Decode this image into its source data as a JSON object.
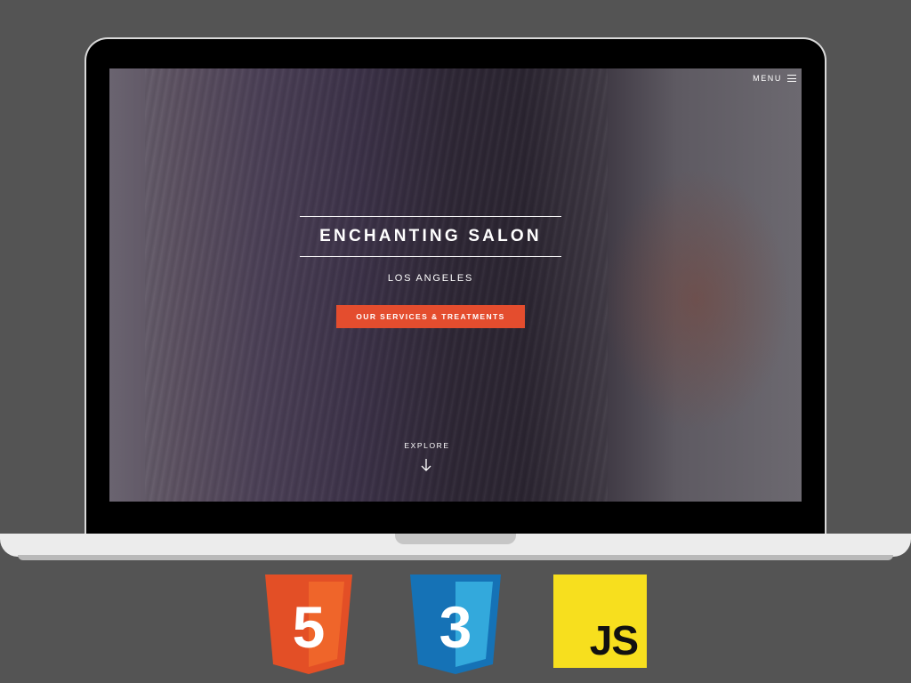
{
  "site": {
    "menu_label": "MENU",
    "title": "ENCHANTING SALON",
    "subtitle": "LOS ANGELES",
    "cta_label": "OUR SERVICES & TREATMENTS",
    "explore_label": "EXPLORE"
  },
  "logos": {
    "html": {
      "digit": "5",
      "color": "#e34f26"
    },
    "css": {
      "digit": "3",
      "color": "#1572b6"
    },
    "js": {
      "text": "JS",
      "color": "#f7df1e"
    }
  },
  "colors": {
    "background": "#545454",
    "cta": "#e44d2e",
    "bezel": "#000000",
    "laptop_base": "#ececec"
  },
  "icons": [
    "hamburger-icon",
    "arrow-down-icon",
    "html5-logo",
    "css3-logo",
    "js-logo"
  ]
}
